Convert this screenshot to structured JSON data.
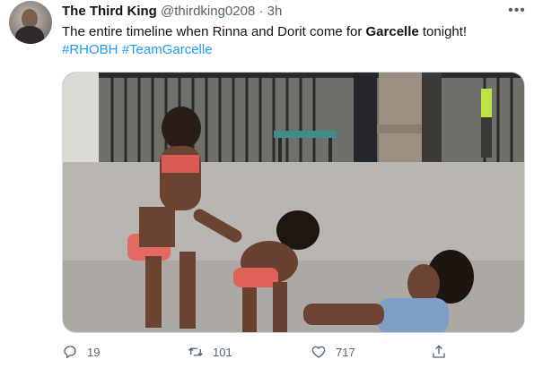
{
  "tweet": {
    "author": {
      "display_name": "The Third King",
      "handle": "@thirdking0208",
      "separator": "·",
      "time": "3h"
    },
    "more_icon": "more-horizontal-icon",
    "text_before": "The entire timeline when Rinna and Dorit come for ",
    "text_bold": "Garcelle",
    "text_after": " tonight!",
    "hashtags": [
      "#RHOBH",
      "#TeamGarcelle"
    ]
  },
  "actions": {
    "reply": {
      "icon": "reply-icon",
      "count": "19"
    },
    "retweet": {
      "icon": "retweet-icon",
      "count": "101"
    },
    "like": {
      "icon": "heart-icon",
      "count": "717"
    },
    "share": {
      "icon": "share-icon"
    }
  },
  "colors": {
    "text": "#0f1419",
    "secondary": "#536471",
    "link": "#1d9bf0",
    "border": "#cfd9de"
  }
}
